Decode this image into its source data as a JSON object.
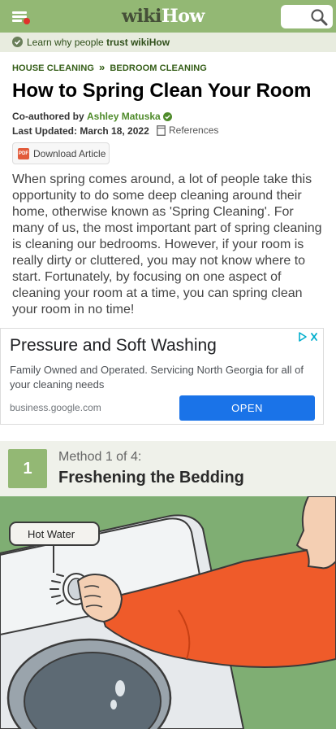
{
  "header": {
    "logo_part1": "wiki",
    "logo_part2": "How",
    "colors": {
      "brand": "#93b874",
      "notification_dot": "#e0312b"
    }
  },
  "trust_bar": {
    "prefix": "Learn why people",
    "emphasis": "trust wikiHow"
  },
  "breadcrumb": [
    "HOUSE CLEANING",
    "BEDROOM CLEANING"
  ],
  "breadcrumb_separator": "»",
  "article": {
    "title": "How to Spring Clean Your Room",
    "coauthor_label": "Co-authored by",
    "author": "Ashley Matuska",
    "updated_label": "Last Updated:",
    "updated_date": "March 18, 2022",
    "references_label": "References",
    "download_label": "Download Article",
    "intro": "When spring comes around, a lot of people take this opportunity to do some deep cleaning around their home, otherwise known as 'Spring Cleaning'. For many of us, the most important part of spring cleaning is cleaning our bedrooms. However, if your room is really dirty or cluttered, you may not know where to start. Fortunately, by focusing on one aspect of cleaning your room at a time, you can spring clean your room in no time!"
  },
  "ad": {
    "headline": "Pressure and Soft Washing",
    "description": "Family Owned and Operated. Servicing North Georgia for all of your cleaning needs",
    "host": "business.google.com",
    "cta": "OPEN"
  },
  "method": {
    "number": "1",
    "subtitle": "Method 1 of 4:",
    "title": "Freshening the Bedding"
  },
  "illustration": {
    "callout_text": "Hot Water"
  }
}
